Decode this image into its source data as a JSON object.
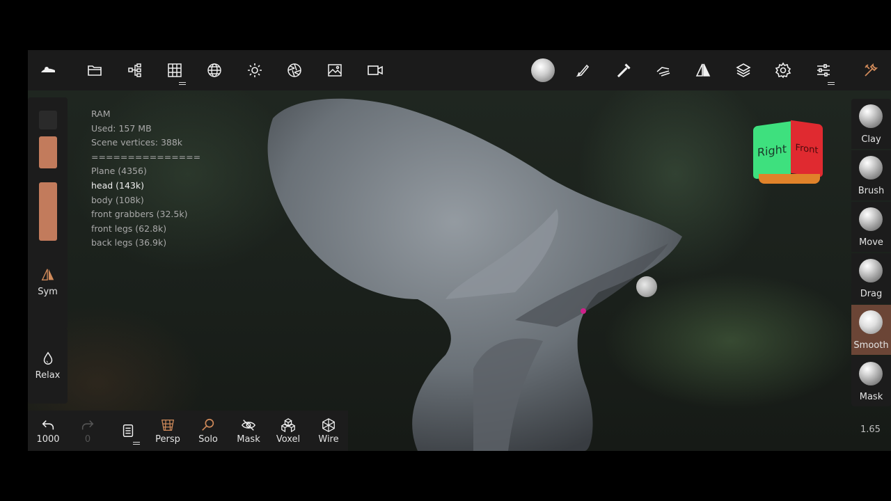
{
  "toolbar": {
    "icons": [
      "app-logo-icon",
      "folder-icon",
      "scene-tree-icon",
      "grid-icon",
      "sphere-icon",
      "sun-icon",
      "aperture-icon",
      "image-icon",
      "camera-icon",
      "material-ball-icon",
      "brush-icon",
      "dropper-icon",
      "hand-icon",
      "symmetry-icon",
      "layers-icon",
      "settings-icon",
      "sliders-icon",
      "tools-icon"
    ]
  },
  "left_panel": {
    "sym_label": "Sym",
    "relax_label": "Relax",
    "slider_color": "#c27b5c"
  },
  "stats": {
    "ram": "RAM",
    "used": "Used: 157 MB",
    "scene_vertices": "Scene vertices: 388k",
    "separator": "===============",
    "objects": [
      "Plane (4356)",
      "head (143k)",
      "body (108k)",
      "front grabbers (32.5k)",
      "front legs (62.8k)",
      "back legs (36.9k)"
    ],
    "active_object": "head (143k)"
  },
  "view_cube": {
    "right": "Right",
    "front": "Front"
  },
  "right_tools": [
    {
      "label": "Clay"
    },
    {
      "label": "Brush"
    },
    {
      "label": "Move"
    },
    {
      "label": "Drag"
    },
    {
      "label": "Smooth",
      "active": true
    },
    {
      "label": "Mask"
    }
  ],
  "bottom": {
    "undo_count": "1000",
    "redo_count": "0",
    "persp": "Persp",
    "solo": "Solo",
    "mask": "Mask",
    "voxel": "Voxel",
    "wire": "Wire",
    "accent": "#d08a5a"
  },
  "zoom_value": "1.65"
}
